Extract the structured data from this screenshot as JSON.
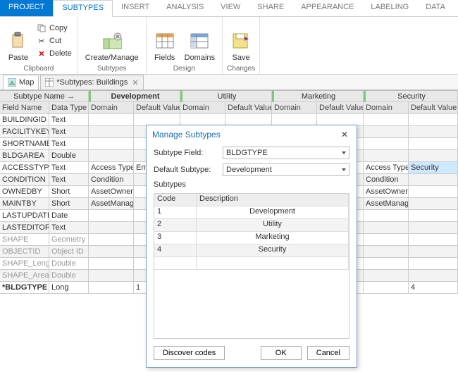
{
  "ribbon": {
    "tabs": {
      "project": "PROJECT",
      "subtypes": "SUBTYPES",
      "insert": "INSERT",
      "analysis": "ANALYSIS",
      "view": "VIEW",
      "share": "SHARE",
      "appearance": "APPEARANCE",
      "labeling": "LABELING",
      "data": "DATA"
    },
    "clipboard": {
      "paste": "Paste",
      "copy": "Copy",
      "cut": "Cut",
      "delete": "Delete",
      "group": "Clipboard"
    },
    "subtypes_group": {
      "create_manage": "Create/Manage",
      "group": "Subtypes"
    },
    "design": {
      "fields": "Fields",
      "domains": "Domains",
      "group": "Design"
    },
    "changes": {
      "save": "Save",
      "group": "Changes"
    }
  },
  "doc_tabs": {
    "map": "Map",
    "subtypes_buildings": "*Subtypes:  Buildings"
  },
  "grid": {
    "subtype_name_label": "Subtype Name →",
    "groups": [
      "Development",
      "Utility",
      "Marketing",
      "Security"
    ],
    "field_name": "Field Name",
    "data_type": "Data Type",
    "domain": "Domain",
    "default_value": "Default Value",
    "rows": [
      {
        "field": "BUILDINGID",
        "type": "Text",
        "dom0": "",
        "dv0": "",
        "domS": "",
        "dvS": ""
      },
      {
        "field": "FACILITYKEY",
        "type": "Text",
        "dom0": "",
        "dv0": "",
        "domS": "",
        "dvS": ""
      },
      {
        "field": "SHORTNAME",
        "type": "Text",
        "dom0": "",
        "dv0": "",
        "domS": "",
        "dvS": ""
      },
      {
        "field": "BLDGAREA",
        "type": "Double",
        "dom0": "",
        "dv0": "",
        "domS": "",
        "dvS": ""
      },
      {
        "field": "ACCESSTYPE",
        "type": "Text",
        "dom0": "Access Type",
        "dv0": "Emp",
        "domS": "Access Type",
        "dvS": "Security"
      },
      {
        "field": "CONDITION",
        "type": "Text",
        "dom0": "Condition",
        "dv0": "",
        "domS": "Condition",
        "dvS": ""
      },
      {
        "field": "OWNEDBY",
        "type": "Short",
        "dom0": "AssetOwner",
        "dv0": "",
        "domS": "AssetOwner",
        "dvS": ""
      },
      {
        "field": "MAINTBY",
        "type": "Short",
        "dom0": "AssetManager",
        "dv0": "",
        "domS": "AssetManager",
        "dvS": ""
      },
      {
        "field": "LASTUPDATE",
        "type": "Date",
        "dom0": "",
        "dv0": "",
        "domS": "",
        "dvS": ""
      },
      {
        "field": "LASTEDITOR",
        "type": "Text",
        "dom0": "",
        "dv0": "",
        "domS": "",
        "dvS": ""
      },
      {
        "field": "SHAPE",
        "type": "Geometry",
        "gray": true,
        "dom0": "",
        "dv0": "",
        "domS": "",
        "dvS": ""
      },
      {
        "field": "OBJECTID",
        "type": "Object ID",
        "gray": true,
        "dom0": "",
        "dv0": "",
        "domS": "",
        "dvS": ""
      },
      {
        "field": "SHAPE_Length",
        "type": "Double",
        "gray": true,
        "dom0": "",
        "dv0": "",
        "domS": "",
        "dvS": ""
      },
      {
        "field": "SHAPE_Area",
        "type": "Double",
        "gray": true,
        "dom0": "",
        "dv0": "",
        "domS": "",
        "dvS": ""
      },
      {
        "field": "*BLDGTYPE",
        "type": "Long",
        "bold": true,
        "dom0": "",
        "dv0": "1",
        "domS": "",
        "dvS": "4"
      }
    ]
  },
  "dialog": {
    "title": "Manage Subtypes",
    "subtype_field_label": "Subtype Field:",
    "subtype_field_value": "BLDGTYPE",
    "default_subtype_label": "Default Subtype:",
    "default_subtype_value": "Development",
    "subtypes_label": "Subtypes",
    "code_col": "Code",
    "desc_col": "Description",
    "rows": [
      {
        "code": "1",
        "desc": "Development"
      },
      {
        "code": "2",
        "desc": "Utility"
      },
      {
        "code": "3",
        "desc": "Marketing"
      },
      {
        "code": "4",
        "desc": "Security"
      }
    ],
    "discover": "Discover codes",
    "ok": "OK",
    "cancel": "Cancel"
  }
}
